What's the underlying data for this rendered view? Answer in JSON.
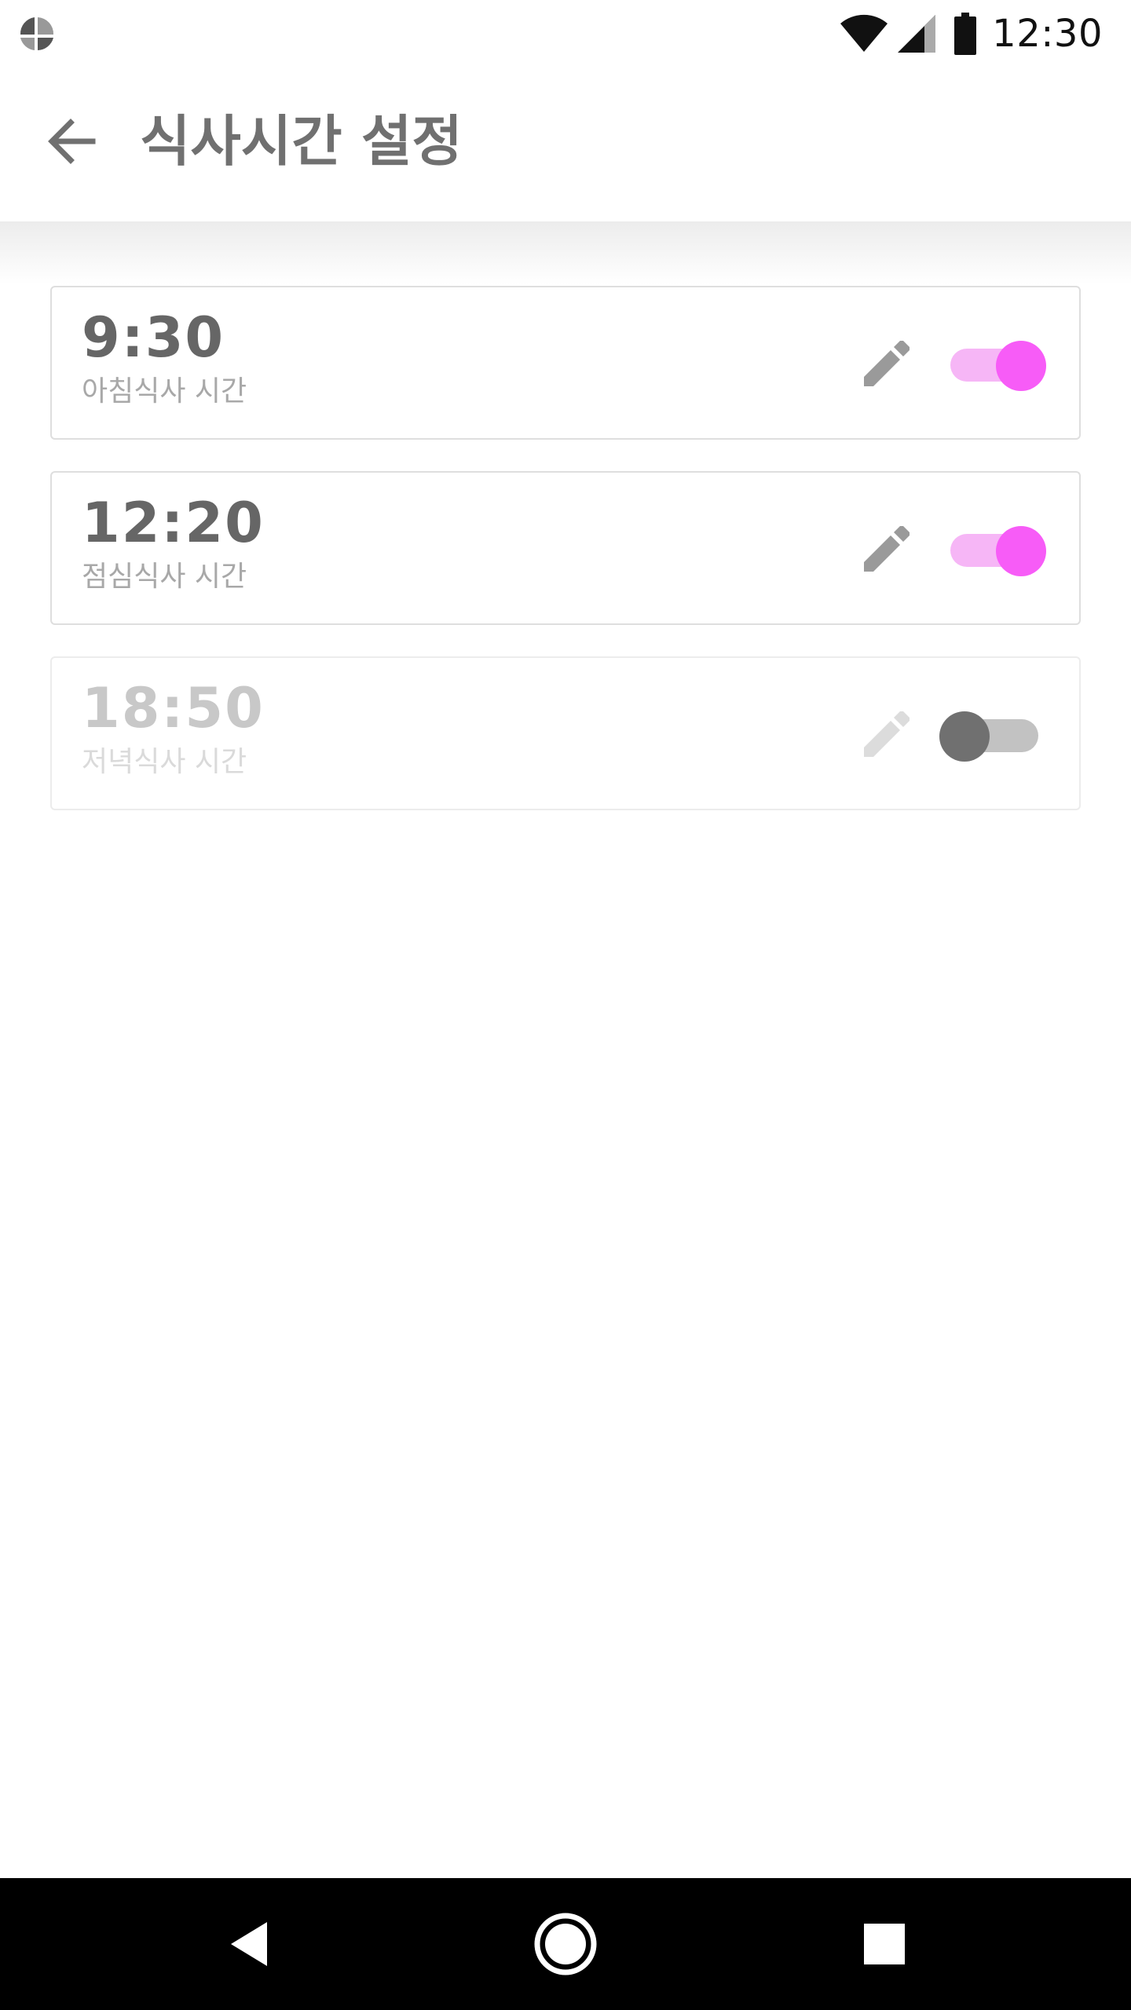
{
  "status_bar": {
    "time": "12:30",
    "icons": [
      "app-notification-icon",
      "wifi-icon",
      "cell-signal-icon",
      "battery-icon"
    ]
  },
  "app_bar": {
    "back_icon": "arrow-left-icon",
    "title": "식사시간 설정"
  },
  "meals": [
    {
      "time": "9:30",
      "label": "아침식사 시간",
      "enabled": true
    },
    {
      "time": "12:20",
      "label": "점심식사 시간",
      "enabled": true
    },
    {
      "time": "18:50",
      "label": "저녁식사 시간",
      "enabled": false
    }
  ],
  "nav_bar": {
    "buttons": [
      "back-triangle-icon",
      "home-circle-icon",
      "recents-square-icon"
    ]
  },
  "colors": {
    "accent": "#f75cf7",
    "accent_track": "#f6b6f6",
    "title_text": "#707070",
    "switch_off_thumb": "#707070",
    "switch_off_track": "#c2c2c2"
  }
}
